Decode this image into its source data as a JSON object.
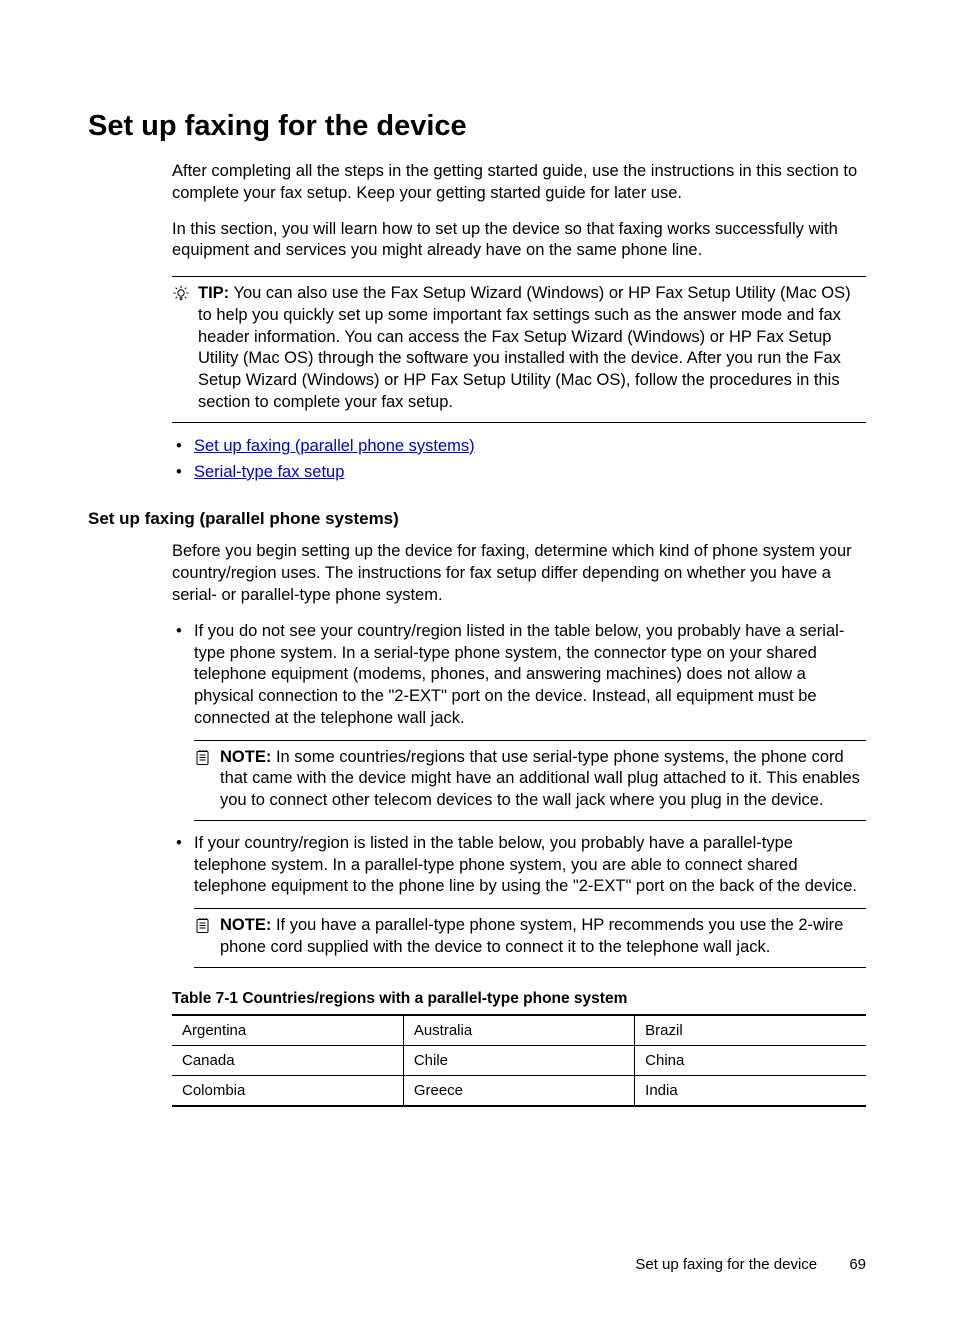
{
  "heading": "Set up faxing for the device",
  "intro": {
    "p1": "After completing all the steps in the getting started guide, use the instructions in this section to complete your fax setup. Keep your getting started guide for later use.",
    "p2": "In this section, you will learn how to set up the device so that faxing works successfully with equipment and services you might already have on the same phone line."
  },
  "tip": {
    "label": "TIP:",
    "text": "You can also use the Fax Setup Wizard (Windows) or HP Fax Setup Utility (Mac OS) to help you quickly set up some important fax settings such as the answer mode and fax header information. You can access the Fax Setup Wizard (Windows) or HP Fax Setup Utility (Mac OS) through the software you installed with the device. After you run the Fax Setup Wizard (Windows) or HP Fax Setup Utility (Mac OS), follow the procedures in this section to complete your fax setup."
  },
  "links": {
    "l1": "Set up faxing (parallel phone systems)",
    "l2": "Serial-type fax setup"
  },
  "section": {
    "title": "Set up faxing (parallel phone systems)",
    "intro": "Before you begin setting up the device for faxing, determine which kind of phone system your country/region uses. The instructions for fax setup differ depending on whether you have a serial- or parallel-type phone system.",
    "b1": "If you do not see your country/region listed in the table below, you probably have a serial-type phone system. In a serial-type phone system, the connector type on your shared telephone equipment (modems, phones, and answering machines) does not allow a physical connection to the \"2-EXT\" port on the device. Instead, all equipment must be connected at the telephone wall jack.",
    "note1": {
      "label": "NOTE:",
      "text": "In some countries/regions that use serial-type phone systems, the phone cord that came with the device might have an additional wall plug attached to it. This enables you to connect other telecom devices to the wall jack where you plug in the device."
    },
    "b2": "If your country/region is listed in the table below, you probably have a parallel-type telephone system. In a parallel-type phone system, you are able to connect shared telephone equipment to the phone line by using the \"2-EXT\" port on the back of the device.",
    "note2": {
      "label": "NOTE:",
      "text": "If you have a parallel-type phone system, HP recommends you use the 2-wire phone cord supplied with the device to connect it to the telephone wall jack."
    }
  },
  "table": {
    "title": "Table 7-1 Countries/regions with a parallel-type phone system",
    "rows": [
      [
        "Argentina",
        "Australia",
        "Brazil"
      ],
      [
        "Canada",
        "Chile",
        "China"
      ],
      [
        "Colombia",
        "Greece",
        "India"
      ]
    ]
  },
  "footer": {
    "text": "Set up faxing for the device",
    "page": "69"
  }
}
